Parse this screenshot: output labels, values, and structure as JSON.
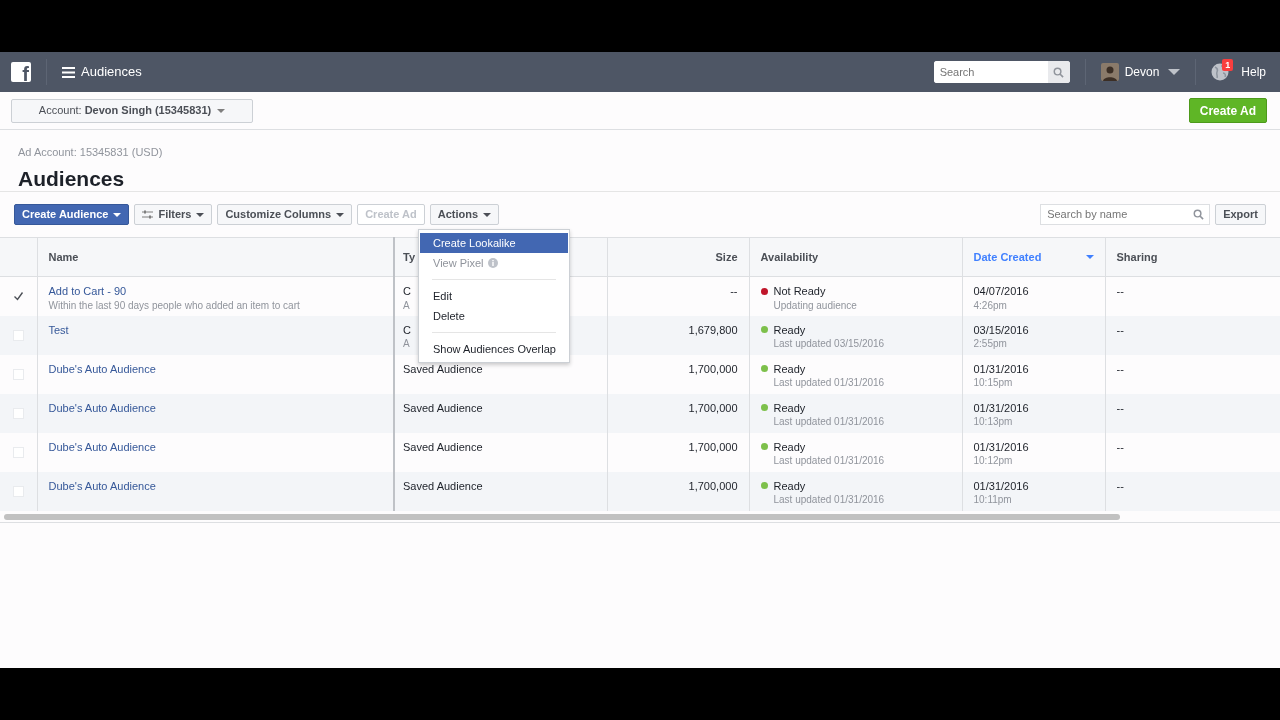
{
  "top_bar": {
    "logo": "f",
    "title": "Audiences",
    "search": {
      "placeholder": "Search"
    },
    "user": {
      "name": "Devon"
    },
    "notifications": "1",
    "help": "Help"
  },
  "account_bar": {
    "label": "Account:",
    "value": "Devon Singh (15345831)",
    "create_ad": "Create Ad"
  },
  "header": {
    "subtitle": "Ad Account: 15345831 (USD)",
    "title": "Audiences"
  },
  "toolbar": {
    "buttons": [
      {
        "label": "Create Audience",
        "kind": "primary",
        "caret": true,
        "disabled": false
      },
      {
        "label": "Filters",
        "kind": "filter",
        "caret": true,
        "disabled": false
      },
      {
        "label": "Customize Columns",
        "kind": "default",
        "caret": true,
        "disabled": false
      },
      {
        "label": "Create Ad",
        "kind": "default",
        "caret": false,
        "disabled": true
      },
      {
        "label": "Actions",
        "kind": "default",
        "caret": true,
        "disabled": false
      }
    ],
    "search": {
      "placeholder": "Search by name"
    },
    "export": "Export"
  },
  "actions_menu": {
    "items": [
      {
        "kind": "item",
        "label": "Create Lookalike",
        "selected": true,
        "disabled": false,
        "info": false
      },
      {
        "kind": "item",
        "label": "View Pixel",
        "selected": false,
        "disabled": true,
        "info": true
      },
      {
        "kind": "divider"
      },
      {
        "kind": "item",
        "label": "Edit",
        "selected": false,
        "disabled": false,
        "info": false
      },
      {
        "kind": "item",
        "label": "Delete",
        "selected": false,
        "disabled": false,
        "info": false
      },
      {
        "kind": "divider"
      },
      {
        "kind": "item",
        "label": "Show Audiences Overlap",
        "selected": false,
        "disabled": false,
        "info": false
      }
    ]
  },
  "table": {
    "columns": [
      {
        "label": "Name",
        "sorted": false
      },
      {
        "label": "Ty",
        "sorted": false
      },
      {
        "label": "Size",
        "sorted": false
      },
      {
        "label": "Availability",
        "sorted": false
      },
      {
        "label": "Date Created",
        "sorted": true
      },
      {
        "label": "Sharing",
        "sorted": false
      }
    ],
    "rows": [
      {
        "checked": true,
        "name": "Add to Cart - 90",
        "description": "Within the last 90 days people who added an item to cart",
        "type": "C",
        "type_detail": "A",
        "size": "--",
        "status": "Not Ready",
        "color": "#c0152a",
        "status_detail": "Updating audience",
        "date": "04/07/2016",
        "time": "4:26pm",
        "sharing": "--"
      },
      {
        "checked": false,
        "name": "Test",
        "type": "C",
        "type_detail": "A",
        "size": "1,679,800",
        "status": "Ready",
        "color": "#7dc04b",
        "status_detail": "Last updated 03/15/2016",
        "date": "03/15/2016",
        "time": "2:55pm",
        "sharing": "--"
      },
      {
        "checked": false,
        "name": "Dube's Auto Audience",
        "type": "Saved Audience",
        "size": "1,700,000",
        "status": "Ready",
        "color": "#7dc04b",
        "status_detail": "Last updated 01/31/2016",
        "date": "01/31/2016",
        "time": "10:15pm",
        "sharing": "--"
      },
      {
        "checked": false,
        "name": "Dube's Auto Audience",
        "type": "Saved Audience",
        "size": "1,700,000",
        "status": "Ready",
        "color": "#7dc04b",
        "status_detail": "Last updated 01/31/2016",
        "date": "01/31/2016",
        "time": "10:13pm",
        "sharing": "--"
      },
      {
        "checked": false,
        "name": "Dube's Auto Audience",
        "type": "Saved Audience",
        "size": "1,700,000",
        "status": "Ready",
        "color": "#7dc04b",
        "status_detail": "Last updated 01/31/2016",
        "date": "01/31/2016",
        "time": "10:12pm",
        "sharing": "--"
      },
      {
        "checked": false,
        "name": "Dube's Auto Audience",
        "type": "Saved Audience",
        "size": "1,700,000",
        "status": "Ready",
        "color": "#7dc04b",
        "status_detail": "Last updated 01/31/2016",
        "date": "01/31/2016",
        "time": "10:11pm",
        "sharing": "--"
      }
    ]
  }
}
